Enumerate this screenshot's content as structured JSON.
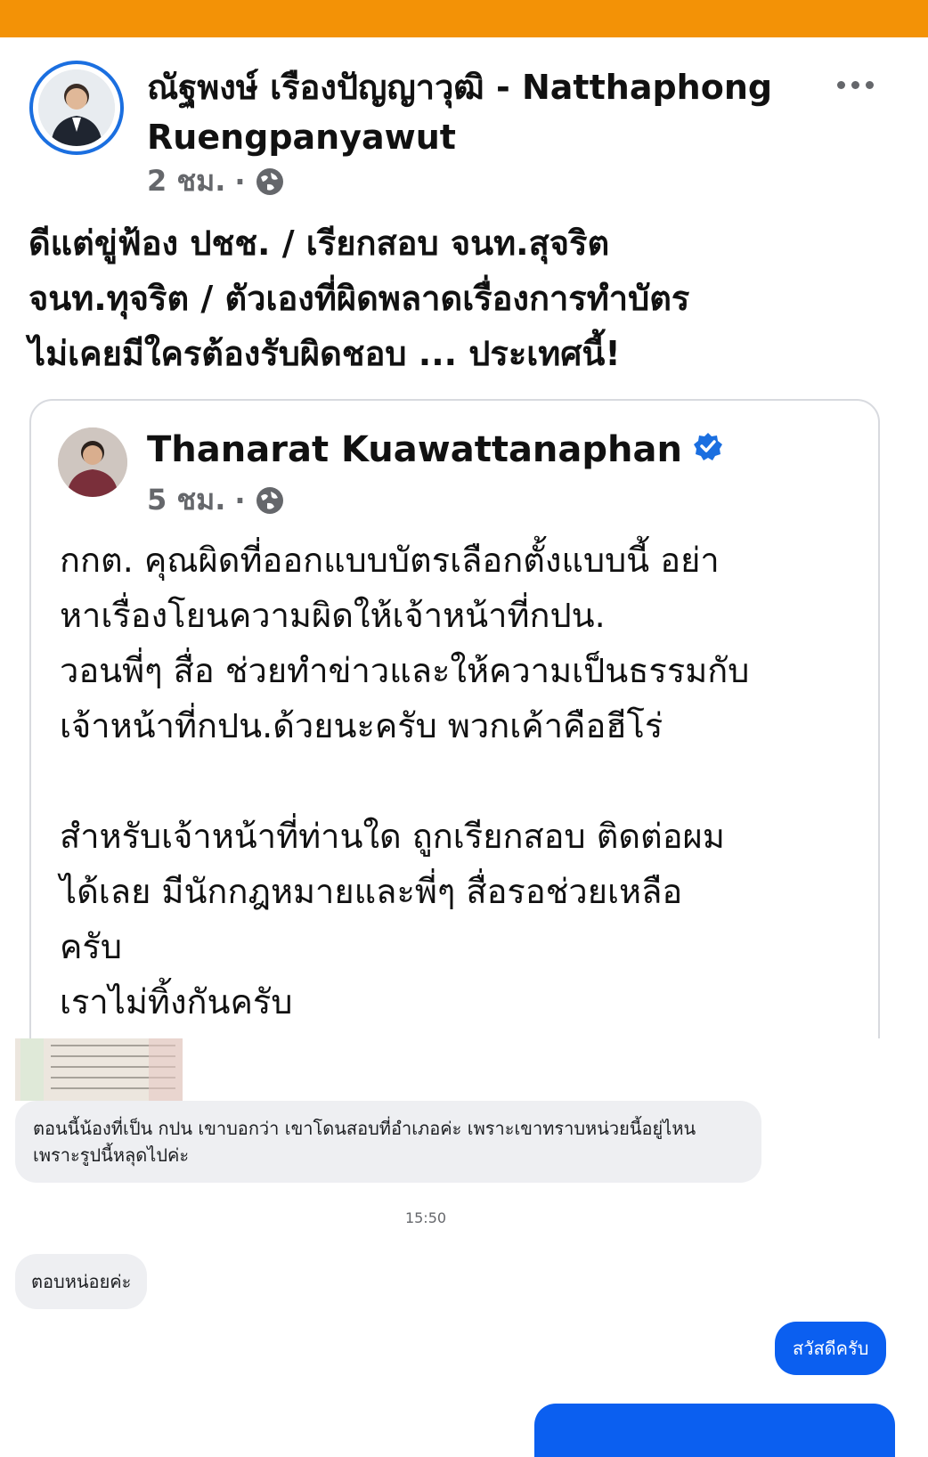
{
  "colors": {
    "topbar": "#f39206",
    "verified": "#1b6fe0",
    "outgoing_bubble": "#0b5ff0"
  },
  "post": {
    "author": "ณัฐพงษ์ เรืองปัญญาวุฒิ - Natthaphong Ruengpanyawut",
    "time": "2 ชม.",
    "text": "ดีแต่ขู่ฟ้อง ปชช. / เรียกสอบ จนท.สุจริต\nจนท.ทุจริต / ตัวเองที่ผิดพลาดเรื่องการทำบัตร\nไม่เคยมีใครต้องรับผิดชอบ ... ประเทศนี้!",
    "icons": {
      "privacy": "globe-icon",
      "more": "more-options-icon"
    }
  },
  "shared": {
    "author": "Thanarat Kuawattanaphan",
    "time": "5 ชม.",
    "verified_icon": "verified-badge-icon",
    "text": "กกต. คุณผิดที่ออกแบบบัตรเลือกตั้งแบบนี้ อย่า\nหาเรื่องโยนความผิดให้เจ้าหน้าที่กปน.\nวอนพี่ๆ สื่อ ช่วยทำข่าวและให้ความเป็นธรรมกับ\nเจ้าหน้าที่กปน.ด้วยนะครับ พวกเค้าคือฮีโร่\n\nสำหรับเจ้าหน้าที่ท่านใด ถูกเรียกสอบ ติดต่อผม\nได้เลย มีนักกฎหมายและพี่ๆ สื่อรอช่วยเหลือ\nครับ\nเราไม่ทิ้งกันครับ"
  },
  "chat": {
    "message1": "ตอนนี้น้องที่เป็น กปน เขาบอกว่า เขาโดนสอบที่อำเภอค่ะ เพราะเขาทราบหน่วยนี้อยู่ไหน\nเพราะรูปนี้หลุดไปค่ะ",
    "timestamp": "15:50",
    "message2": "ตอบหน่อยค่ะ",
    "reply1": "สวัสดีครับ"
  }
}
